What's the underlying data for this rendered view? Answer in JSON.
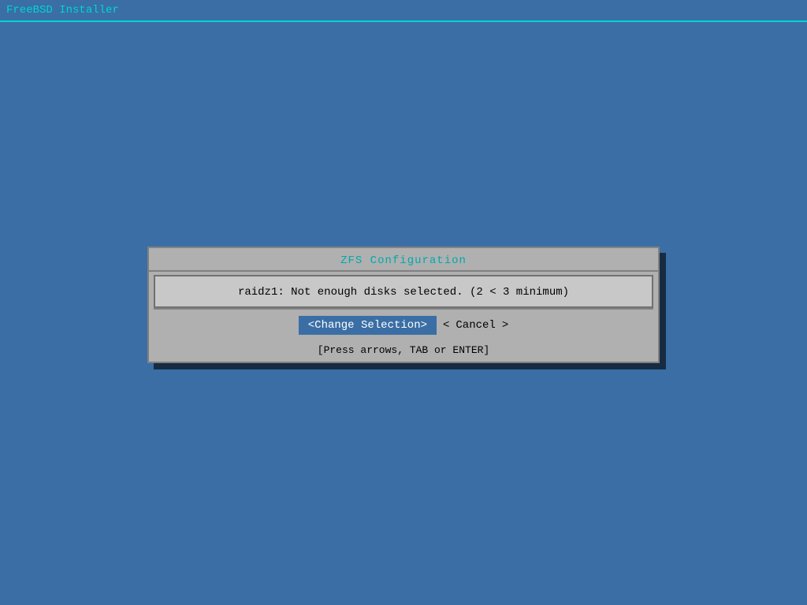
{
  "titleBar": {
    "label": "FreeBSD Installer"
  },
  "dialog": {
    "title": "ZFS Configuration",
    "message": "raidz1: Not enough disks selected. (2 < 3 minimum)",
    "buttons": {
      "changeSelection": "<Change Selection>",
      "cancelLeft": "<",
      "cancel": "Cancel",
      "cancelRight": ">"
    },
    "hint": "[Press arrows, TAB or ENTER]"
  },
  "colors": {
    "background": "#3a6ea5",
    "titleBarBorder": "#00d5d5",
    "titleText": "#00d5d5",
    "dialogTitle": "#00aaaa",
    "dialogBg": "#b0b0b0",
    "dialogMessageBg": "#c8c8c8",
    "selectedButtonBg": "#3a6ea5",
    "selectedButtonText": "#ffffff"
  }
}
